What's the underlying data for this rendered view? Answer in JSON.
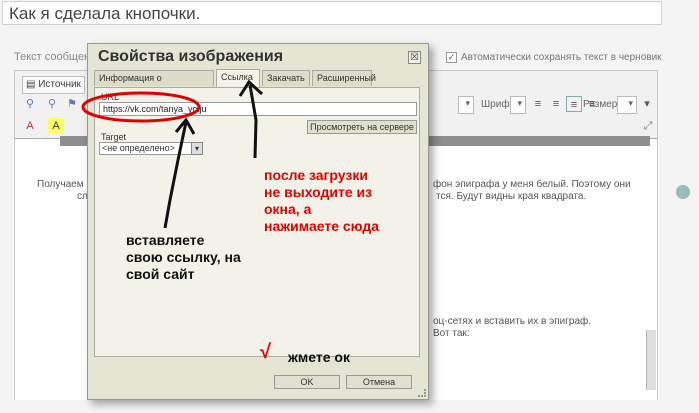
{
  "page": {
    "title_value": "Как я сделала кнопочки."
  },
  "editor": {
    "message_label": "Текст сообщени",
    "autosave_label": "Автоматически сохранять текст в черновик",
    "source_label": "Источник",
    "font_label": "Шрифт",
    "size_label": "Размер",
    "text_line1a": "Получаем к",
    "text_line1b": "фон эпиграфа у меня белый. Поэтому они",
    "text_line2a": "сл",
    "text_line2b": "тся. Будут видны края квадрата.",
    "text_line3a": "оц-сетях и вставить их в эпиграф.",
    "text_line4a": "Вот так:"
  },
  "dialog": {
    "title": "Свойства изображения",
    "close_glyph": "☒",
    "tabs": [
      "Информация о изображении",
      "Ссылка",
      "Закачать",
      "Расширенный"
    ],
    "url_label": "URL",
    "url_value": "https://vk.com/tanya_yolju",
    "browse_server_label": "Просмотреть на сервере",
    "target_label": "Target",
    "target_value": "<не определено>",
    "ok_label": "OK",
    "cancel_label": "Отмена"
  },
  "annotations": {
    "note_after_upload": "после загрузки\nне выходите из\nокна, а\nнажимаете сюда",
    "note_insert_link": "вставляете\nсвою ссылку, на\nсвой сайт",
    "note_press_ok": "жмете ок",
    "check_mark": "√"
  },
  "colors": {
    "annotation_red": "#e00000",
    "dialog_bg": "#e5e5d4"
  }
}
